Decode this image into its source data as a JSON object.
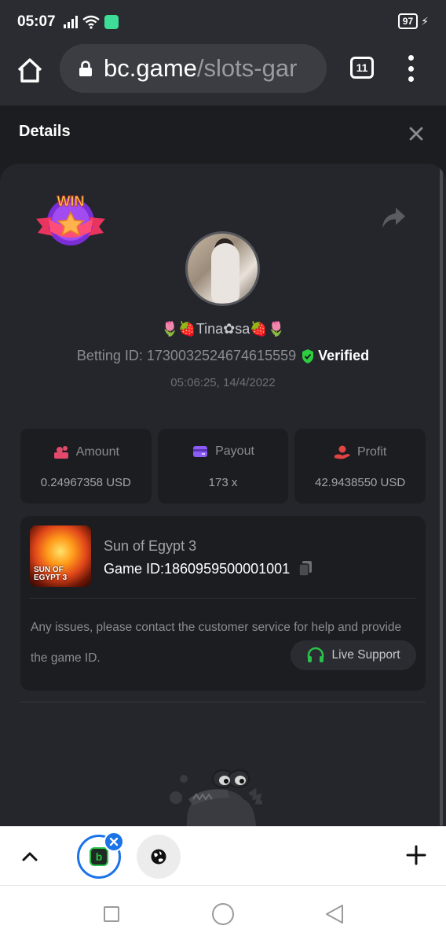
{
  "status_bar": {
    "time": "05:07",
    "battery": "97"
  },
  "browser": {
    "url_host": "bc.game",
    "url_path": "/slots-gar",
    "tab_count": "11"
  },
  "modal": {
    "title": "Details"
  },
  "bet": {
    "username": "🌷🍓Tina✿sa🍓🌷",
    "betting_id_label": "Betting ID: 1730032524674615559",
    "verified_label": "Verified",
    "timestamp": "05:06:25, 14/4/2022"
  },
  "stats": [
    {
      "label": "Amount",
      "value": "0.24967358 USD",
      "icon": "coins-icon",
      "color": "#e2496b"
    },
    {
      "label": "Payout",
      "value": "173 x",
      "icon": "wallet-icon",
      "color": "#8b5cf6"
    },
    {
      "label": "Profit",
      "value": "42.9438550 USD",
      "icon": "hand-coin-icon",
      "color": "#e24444"
    }
  ],
  "game": {
    "name": "Sun of Egypt 3",
    "id_label": "Game ID:1860959500001001",
    "thumb_label_1": "SUN OF",
    "thumb_label_2": "EGYPT 3",
    "notice": "Any issues, please contact the customer service for help and provide the game ID.",
    "live_support_label": "Live Support"
  },
  "colors": {
    "accent_green": "#29c04a",
    "verified_green": "#2ecc40",
    "tab_blue": "#1a73e8"
  }
}
